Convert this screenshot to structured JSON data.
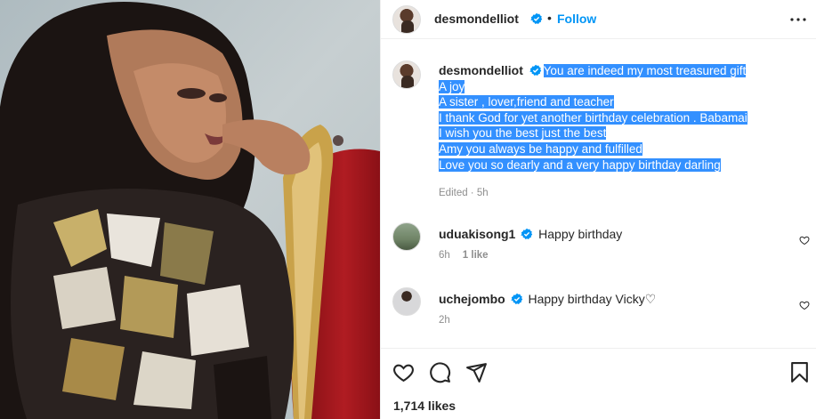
{
  "post": {
    "username": "desmondelliot",
    "follow_label": "Follow",
    "caption_lines": [
      "You are indeed my most treasured gift",
      "A joy",
      "A sister , lover,friend and teacher",
      "I thank God for yet another birthday celebration . Babamai",
      "I wish you the best just the best",
      "Amy you always be happy and fulfilled",
      "Love you so dearly and a very happy birthday darling"
    ],
    "caption_meta": "Edited · 5h",
    "likes": "1,714 likes"
  },
  "comments": [
    {
      "username": "uduakisong1",
      "text": "Happy birthday",
      "time": "6h",
      "likes": "1 like"
    },
    {
      "username": "uchejombo",
      "text": "Happy birthday Vicky♡",
      "time": "2h",
      "likes": ""
    }
  ],
  "colors": {
    "accent": "#0095f6",
    "selection": "#3390ff",
    "verified": "#0095f6",
    "muted": "#8e8e8e"
  },
  "icons": [
    "verified-badge-icon",
    "more-options-icon",
    "heart-icon",
    "comment-icon",
    "share-icon",
    "bookmark-icon"
  ]
}
